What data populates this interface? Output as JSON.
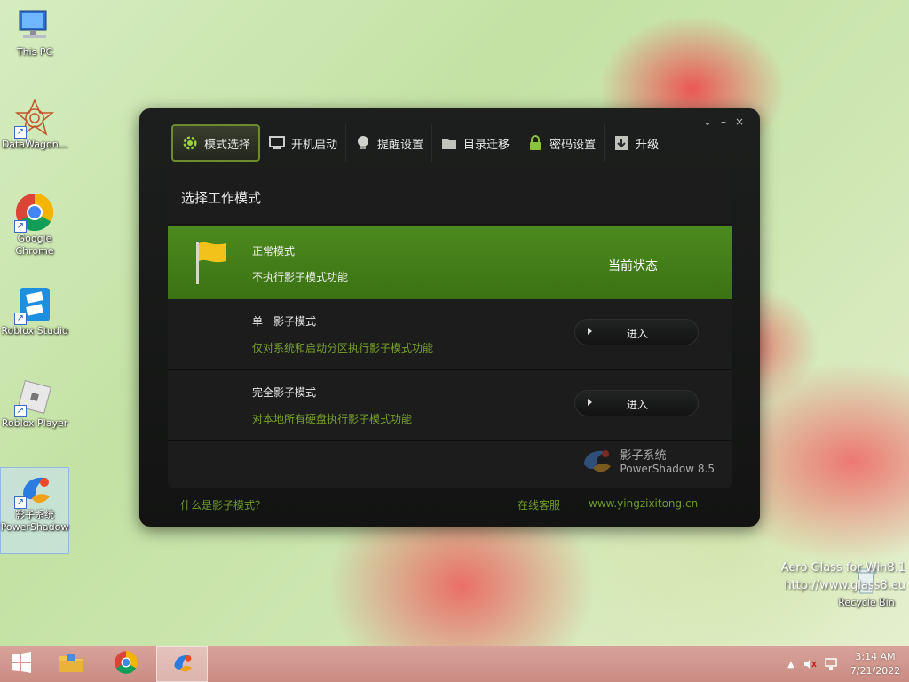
{
  "desktop": {
    "icons": [
      {
        "label": "This PC"
      },
      {
        "label": "DataWagon..."
      },
      {
        "label": "Google Chrome"
      },
      {
        "label": "Roblox Studio"
      },
      {
        "label": "Roblox Player"
      },
      {
        "label": "影子系统 PowerShadow"
      }
    ],
    "recycle_bin": "Recycle Bin",
    "watermark_line1": "Aero Glass for Win8.1",
    "watermark_line2": "http://www.glass8.eu"
  },
  "window": {
    "controls": {
      "restore": "⌄",
      "minimize": "–",
      "close": "×"
    },
    "tabs": [
      {
        "label": "模式选择",
        "icon": "gear-icon",
        "active": true
      },
      {
        "label": "开机启动",
        "icon": "monitor-icon"
      },
      {
        "label": "提醒设置",
        "icon": "bulb-icon"
      },
      {
        "label": "目录迁移",
        "icon": "folder-icon"
      },
      {
        "label": "密码设置",
        "icon": "lock-icon"
      },
      {
        "label": "升级",
        "icon": "download-icon"
      }
    ],
    "panel_title": "选择工作模式",
    "modes": {
      "normal": {
        "title": "正常模式",
        "desc": "不执行影子模式功能",
        "state": "当前状态"
      },
      "single": {
        "title": "单一影子模式",
        "desc": "仅对系统和启动分区执行影子模式功能",
        "button": "进入"
      },
      "full": {
        "title": "完全影子模式",
        "desc": "对本地所有硬盘执行影子模式功能",
        "button": "进入"
      }
    },
    "brand": {
      "name": "影子系统",
      "sub": "PowerShadow",
      "version": "8.5"
    },
    "footer": {
      "help_link": "什么是影子模式？",
      "support_link": "在线客服",
      "website_link": "www.yingzixitong.cn"
    }
  },
  "taskbar": {
    "time": "3:14 AM",
    "date": "7/21/2022"
  },
  "colors": {
    "accent_green": "#4c8a1d",
    "link_green": "#6f9a2a",
    "window_bg": "#1b1c1b"
  }
}
